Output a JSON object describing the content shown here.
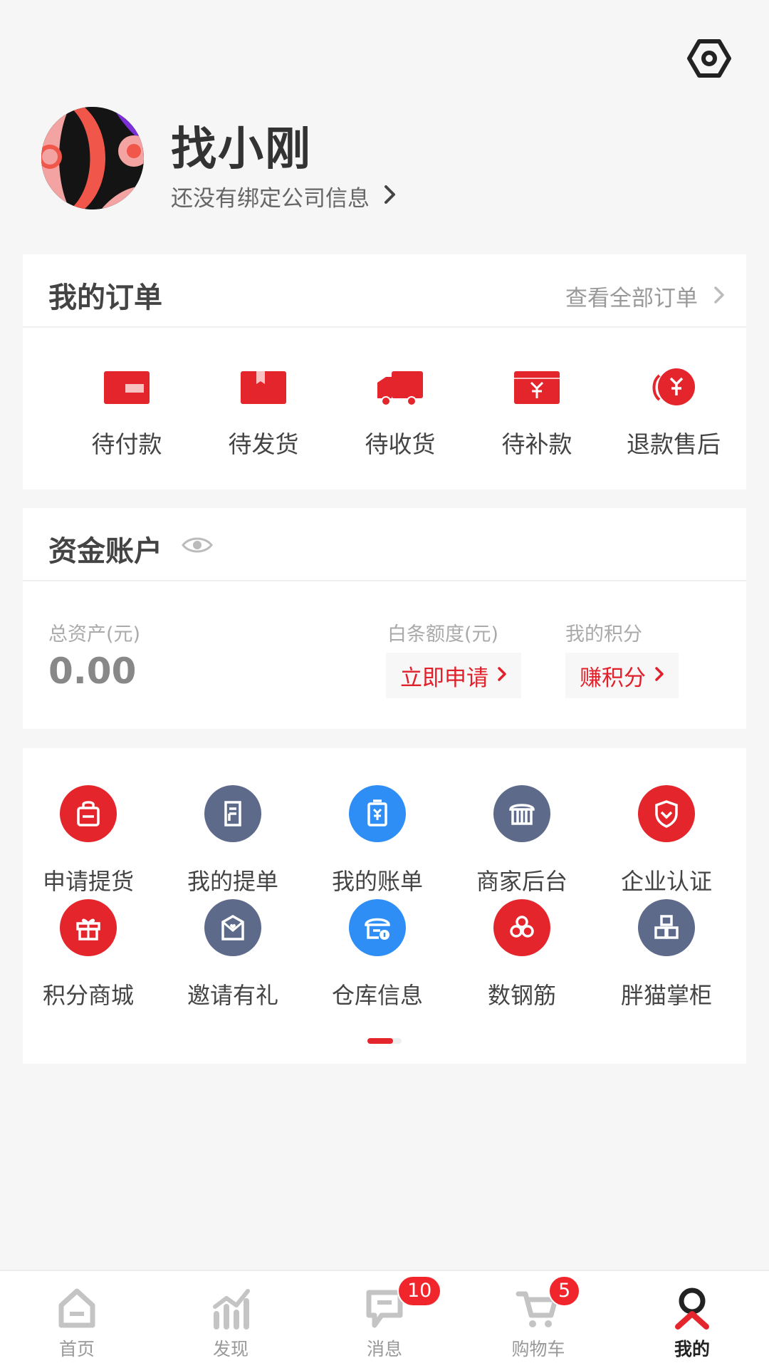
{
  "header": {
    "user_name": "找小刚",
    "company_hint": "还没有绑定公司信息"
  },
  "orders": {
    "title": "我的订单",
    "view_all": "查看全部订单",
    "items": [
      {
        "label": "待付款",
        "icon": "wallet-icon"
      },
      {
        "label": "待发货",
        "icon": "package-icon"
      },
      {
        "label": "待收货",
        "icon": "truck-icon"
      },
      {
        "label": "待补款",
        "icon": "yuan-box-icon"
      },
      {
        "label": "退款售后",
        "icon": "refund-icon"
      }
    ]
  },
  "funds": {
    "title": "资金账户",
    "total_label": "总资产(元)",
    "total_value": "0.00",
    "credit_label": "白条额度(元)",
    "credit_action": "立即申请",
    "points_label": "我的积分",
    "points_action": "赚积分"
  },
  "tools": [
    {
      "label": "申请提货",
      "icon": "pickup-bag-icon",
      "color": "red"
    },
    {
      "label": "我的提单",
      "icon": "document-icon",
      "color": "slate"
    },
    {
      "label": "我的账单",
      "icon": "bill-icon",
      "color": "blue"
    },
    {
      "label": "商家后台",
      "icon": "store-icon",
      "color": "slate"
    },
    {
      "label": "企业认证",
      "icon": "shield-check-icon",
      "color": "red"
    },
    {
      "label": "积分商城",
      "icon": "gift-icon",
      "color": "red"
    },
    {
      "label": "邀请有礼",
      "icon": "invite-mail-icon",
      "color": "slate"
    },
    {
      "label": "仓库信息",
      "icon": "warehouse-icon",
      "color": "blue"
    },
    {
      "label": "数钢筋",
      "icon": "rebar-icon",
      "color": "red"
    },
    {
      "label": "胖猫掌柜",
      "icon": "boxes-icon",
      "color": "slate"
    }
  ],
  "tabbar": {
    "items": [
      {
        "label": "首页",
        "icon": "home-icon"
      },
      {
        "label": "发现",
        "icon": "discover-chart-icon"
      },
      {
        "label": "消息",
        "icon": "message-icon",
        "badge": "10"
      },
      {
        "label": "购物车",
        "icon": "cart-icon",
        "badge": "5"
      },
      {
        "label": "我的",
        "icon": "profile-icon",
        "active": true
      }
    ]
  },
  "colors": {
    "accent": "#e5252c",
    "slate": "#5d6a8a",
    "blue": "#2e8ef5"
  }
}
